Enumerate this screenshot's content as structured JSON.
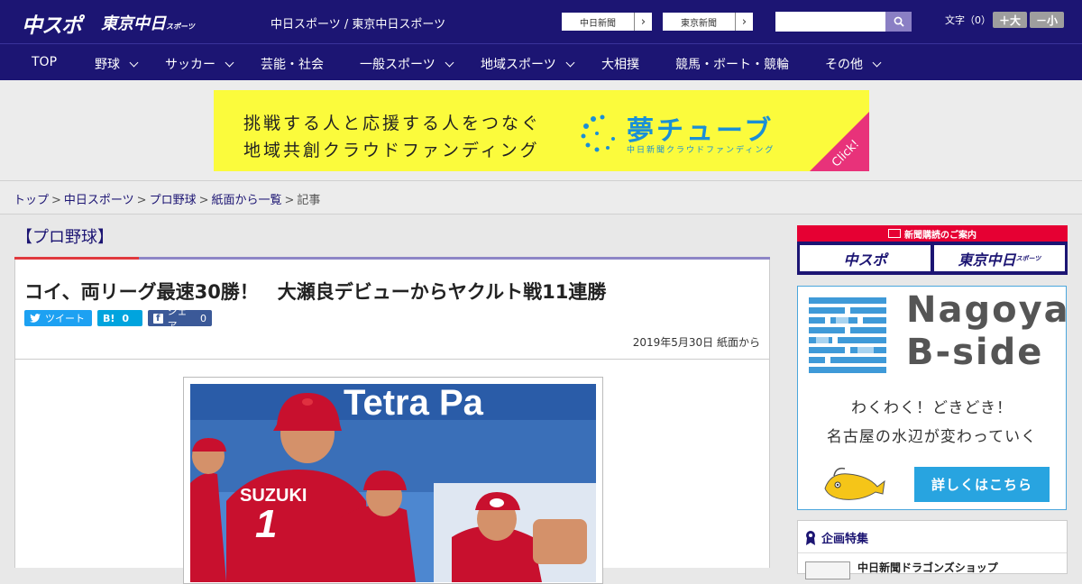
{
  "header": {
    "logo_chuspo": "中スポ",
    "logo_tokyo": "東京中日",
    "logo_tokyo_small": "スポーツ",
    "site_title": "中日スポーツ / 東京中日スポーツ",
    "ext_links": [
      "中日新聞",
      "東京新聞"
    ],
    "search_placeholder": "",
    "font_label": "文字（0）",
    "font_bigger": "＋大",
    "font_smaller": "－小"
  },
  "nav": {
    "items": [
      {
        "label": "TOP",
        "has_dropdown": false
      },
      {
        "label": "野球",
        "has_dropdown": true
      },
      {
        "label": "サッカー",
        "has_dropdown": true
      },
      {
        "label": "芸能・社会",
        "has_dropdown": false
      },
      {
        "label": "一般スポーツ",
        "has_dropdown": true
      },
      {
        "label": "地域スポーツ",
        "has_dropdown": true
      },
      {
        "label": "大相撲",
        "has_dropdown": false
      },
      {
        "label": "競馬・ボート・競輪",
        "has_dropdown": false
      },
      {
        "label": "その他",
        "has_dropdown": true
      }
    ]
  },
  "banner": {
    "line1": "挑戦する人と応援する人をつなぐ",
    "line2": "地域共創クラウドファンディング",
    "brand": "夢チューブ",
    "sub": "中日新聞クラウドファンディング",
    "click": "Click!"
  },
  "breadcrumb": {
    "links": [
      "トップ",
      "中日スポーツ",
      "プロ野球",
      "紙面から一覧"
    ],
    "current": "記事"
  },
  "article": {
    "category": "【プロ野球】",
    "headline": "コイ、両リーグ最速30勝！　大瀬良デビューからヤクルト戦11連勝",
    "tweet": "ツイート",
    "hatebu": "B!",
    "hatebu_count": "0",
    "share": "シェア",
    "share_count": "0",
    "date": "2019年5月30日",
    "source": "紙面から",
    "photo_banner_text": "Tetra Pa",
    "photo_jersey_name": "SUZUKI",
    "photo_jersey_number": "1"
  },
  "sidebar": {
    "subscribe_title": "新聞購読のご案内",
    "subscribe_btn1": "中スポ",
    "subscribe_btn2": "東京中日",
    "subscribe_btn2_small": "スポーツ",
    "bside_title1": "Nagoya",
    "bside_title2": "B-side",
    "bside_text1": "わくわく！どきどき！",
    "bside_text2": "名古屋の水辺が変わっていく",
    "bside_btn": "詳しくはこちら",
    "special_heading": "企画特集",
    "special_item": "中日新聞ドラゴンズショップ"
  },
  "colors": {
    "brand_navy": "#1c1573",
    "accent_red": "#e0393e",
    "banner_yellow": "#fbfb3c",
    "bside_blue": "#28a4e0"
  }
}
